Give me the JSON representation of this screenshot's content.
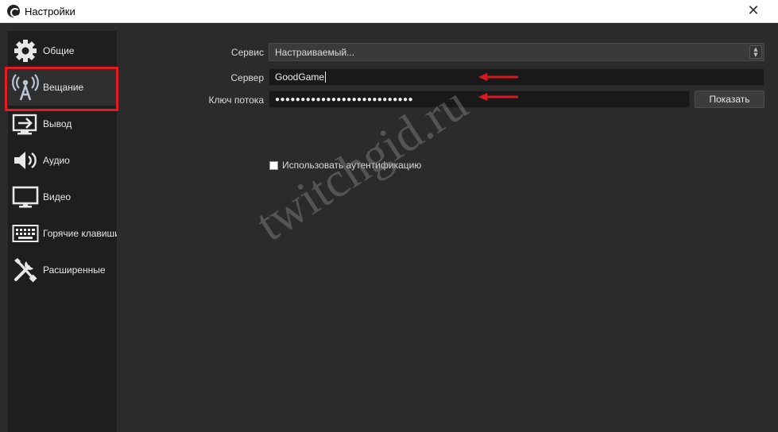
{
  "window": {
    "title": "Настройки",
    "icon": "obs-logo-icon",
    "close_glyph": "✕"
  },
  "sidebar": {
    "items": [
      {
        "label": "Общие",
        "icon": "gear-icon",
        "active": false
      },
      {
        "label": "Вещание",
        "icon": "broadcast-antenna-icon",
        "active": true
      },
      {
        "label": "Вывод",
        "icon": "output-icon",
        "active": false
      },
      {
        "label": "Аудио",
        "icon": "speaker-icon",
        "active": false
      },
      {
        "label": "Видео",
        "icon": "monitor-icon",
        "active": false
      },
      {
        "label": "Горячие клавиши",
        "icon": "keyboard-icon",
        "active": false
      },
      {
        "label": "Расширенные",
        "icon": "tools-icon",
        "active": false
      }
    ]
  },
  "stream": {
    "service_label": "Сервис",
    "service_value": "Настраиваемый...",
    "server_label": "Сервер",
    "server_value": "GoodGame",
    "key_label": "Ключ потока",
    "key_value": "●●●●●●●●●●●●●●●●●●●●●●●●●●●",
    "show_button": "Показать",
    "auth_checkbox_label": "Использовать аутентификацию",
    "auth_checked": false
  },
  "annotations": {
    "highlight_color": "#e11b22",
    "arrow_color": "#d71920"
  },
  "watermark": {
    "text": "twitchgid.ru"
  },
  "colors": {
    "window_bg": "#2b2b2b",
    "sidebar_bg": "#1e1e1e",
    "field_bg": "#191919"
  }
}
